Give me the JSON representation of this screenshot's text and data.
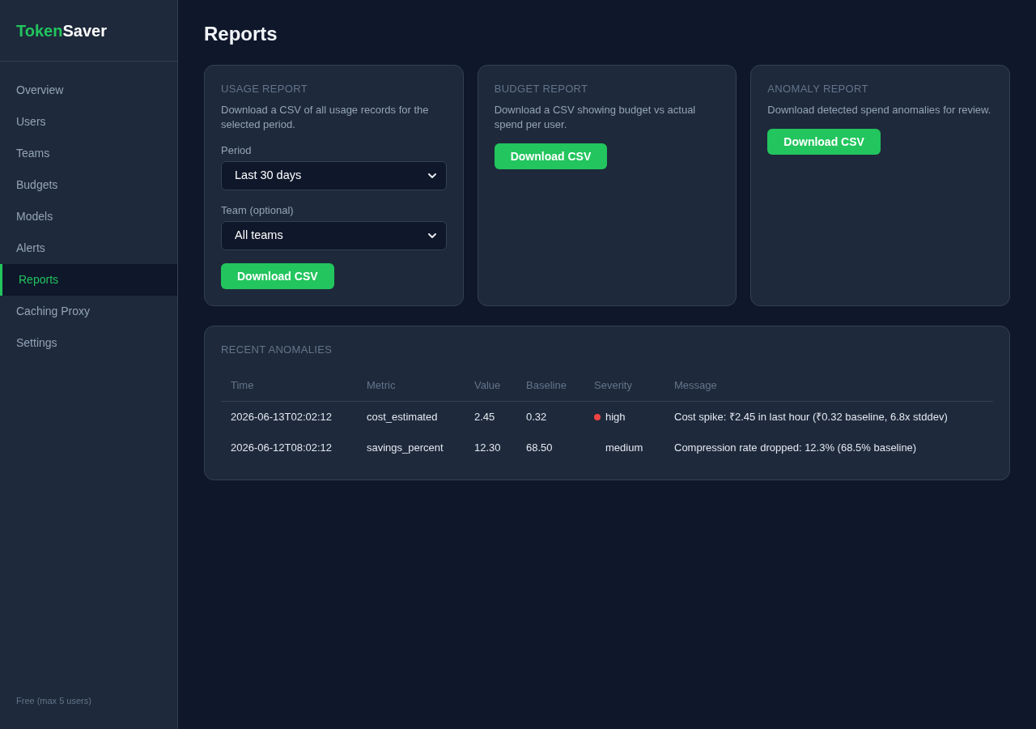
{
  "sidebar": {
    "logo": {
      "accent": "Token",
      "rest": "Saver"
    },
    "items": [
      {
        "label": "Overview",
        "selected": false
      },
      {
        "label": "Users",
        "selected": false
      },
      {
        "label": "Teams",
        "selected": false
      },
      {
        "label": "Budgets",
        "selected": false
      },
      {
        "label": "Models",
        "selected": false
      },
      {
        "label": "Alerts",
        "selected": false
      },
      {
        "label": "Reports",
        "selected": true
      },
      {
        "label": "Caching Proxy",
        "selected": false
      },
      {
        "label": "Settings",
        "selected": false
      }
    ],
    "plan": "Free (max 5 users)"
  },
  "page": {
    "title": "Reports"
  },
  "report_cards": [
    {
      "heading": "USAGE REPORT",
      "description": "Download a CSV of all usage records for the selected period.",
      "filters": [
        {
          "label": "Period",
          "value": "Last 30 days"
        },
        {
          "label": "Team (optional)",
          "value": "All teams"
        }
      ],
      "button": "Download CSV"
    },
    {
      "heading": "BUDGET REPORT",
      "description": "Download a CSV showing budget vs actual spend per user.",
      "button": "Download CSV"
    },
    {
      "heading": "ANOMALY REPORT",
      "description": "Download detected spend anomalies for review.",
      "button": "Download CSV"
    }
  ],
  "anomalies": {
    "heading": "RECENT ANOMALIES",
    "columns": [
      "Time",
      "Metric",
      "Value",
      "Baseline",
      "Severity",
      "Message"
    ],
    "rows": [
      {
        "time": "2026-06-13T02:02:12",
        "metric": "cost_estimated",
        "value": "2.45",
        "baseline": "0.32",
        "severity": "high",
        "color": "#ef4444",
        "message": "Cost spike: ₹2.45 in last hour (₹0.32 baseline, 6.8x stddev)"
      },
      {
        "time": "2026-06-12T08:02:12",
        "metric": "savings_percent",
        "value": "12.30",
        "baseline": "68.50",
        "severity": "medium",
        "message": "Compression rate dropped: 12.3% (68.5% baseline)"
      }
    ]
  }
}
